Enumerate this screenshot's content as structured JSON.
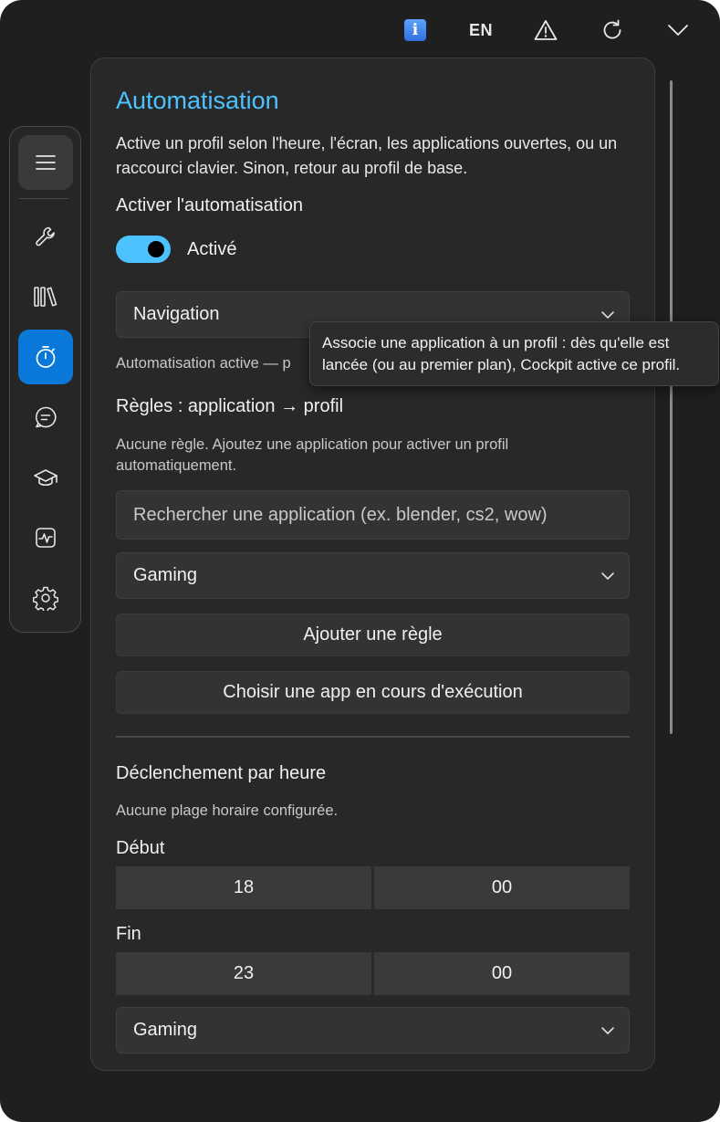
{
  "topbar": {
    "info_icon": "info-icon",
    "info_glyph": "i",
    "lang": "EN",
    "warn_icon": "warning-icon",
    "refresh_icon": "refresh-icon",
    "chevron_icon": "chevron-down-icon"
  },
  "sidebar": {
    "items": [
      {
        "name": "menu",
        "icon": "hamburger-icon"
      },
      {
        "name": "tools",
        "icon": "wrench-icon"
      },
      {
        "name": "library",
        "icon": "library-icon"
      },
      {
        "name": "automation",
        "icon": "timer-icon",
        "active": true
      },
      {
        "name": "chat",
        "icon": "chat-icon"
      },
      {
        "name": "learn",
        "icon": "graduation-cap-icon"
      },
      {
        "name": "monitor",
        "icon": "activity-icon"
      },
      {
        "name": "settings",
        "icon": "gear-icon"
      }
    ]
  },
  "main": {
    "title": "Automatisation",
    "description": "Active un profil selon l'heure, l'écran, les applications ouvertes, ou un raccourci clavier. Sinon, retour au profil de base.",
    "enable_label": "Activer l'automatisation",
    "toggle_state": "Activé",
    "base_profile": "Navigation",
    "status_text": "Automatisation active — p",
    "rules_heading": "Règles : application → profil",
    "no_rules_text": "Aucune règle. Ajoutez une application pour activer un profil automatiquement.",
    "search_placeholder": "Rechercher une application (ex. blender, cs2, wow)",
    "rule_profile": "Gaming",
    "add_rule_button": "Ajouter une règle",
    "pick_running_app_button": "Choisir une app en cours d'exécution",
    "time_trigger_heading": "Déclenchement par heure",
    "no_time_range_text": "Aucune plage horaire configurée.",
    "start_label": "Début",
    "start_hour": "18",
    "start_minute": "00",
    "end_label": "Fin",
    "end_hour": "23",
    "end_minute": "00",
    "time_profile": "Gaming"
  },
  "tooltip": {
    "text": "Associe une application à un profil : dès qu'elle est lancée (ou au premier plan), Cockpit active ce profil."
  },
  "colors": {
    "accent": "#4cc2ff",
    "active_nav": "#0a78d8",
    "window_bg": "#1f1f1f",
    "panel_bg": "#282828"
  }
}
